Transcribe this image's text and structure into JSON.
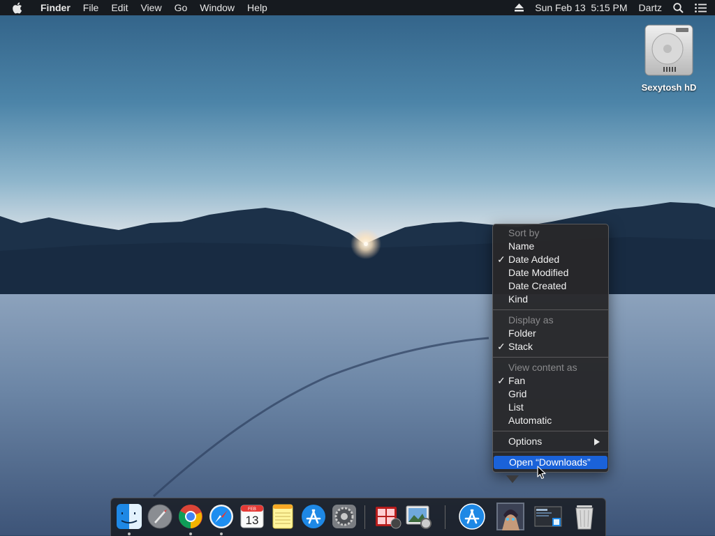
{
  "menubar": {
    "app_name": "Finder",
    "menus": [
      "File",
      "Edit",
      "View",
      "Go",
      "Window",
      "Help"
    ],
    "datetime": "Sun Feb 13  5:15 PM",
    "user": "Dartz"
  },
  "desktop": {
    "disk_label": "Sexytosh hD"
  },
  "context_menu": {
    "sort_by": {
      "header": "Sort by",
      "items": [
        {
          "label": "Name",
          "checked": false
        },
        {
          "label": "Date Added",
          "checked": true
        },
        {
          "label": "Date Modified",
          "checked": false
        },
        {
          "label": "Date Created",
          "checked": false
        },
        {
          "label": "Kind",
          "checked": false
        }
      ]
    },
    "display_as": {
      "header": "Display as",
      "items": [
        {
          "label": "Folder",
          "checked": false
        },
        {
          "label": "Stack",
          "checked": true
        }
      ]
    },
    "view_content_as": {
      "header": "View content as",
      "items": [
        {
          "label": "Fan",
          "checked": true
        },
        {
          "label": "Grid",
          "checked": false
        },
        {
          "label": "List",
          "checked": false
        },
        {
          "label": "Automatic",
          "checked": false
        }
      ]
    },
    "options_label": "Options",
    "open_label": "Open “Downloads”",
    "check_glyph": "✓"
  },
  "dock": {
    "calendar_month": "FEB",
    "calendar_day": "13",
    "apps": [
      "finder-icon",
      "launchpad-icon",
      "chrome-icon",
      "safari-icon",
      "calendar-icon",
      "notes-icon",
      "app-store-icon",
      "system-preferences-icon",
      "photo-booth-icon",
      "preview-icon",
      "app-store-folder-icon",
      "downloads-stack-icon",
      "screenshot-stack-icon",
      "trash-icon"
    ]
  },
  "colors": {
    "menubar_bg": "#161a1f",
    "menu_highlight": "#1a62d9",
    "menu_bg": "#28282a"
  }
}
